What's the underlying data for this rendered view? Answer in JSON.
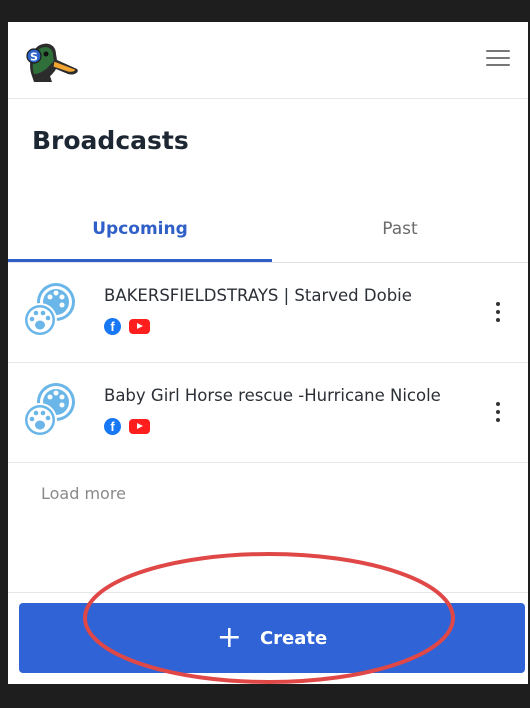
{
  "header": {
    "logo_icon": "duck-mascot-logo-icon",
    "menu_icon": "hamburger-menu-icon"
  },
  "page": {
    "title": "Broadcasts"
  },
  "tabs": [
    {
      "label": "Upcoming",
      "active": true
    },
    {
      "label": "Past",
      "active": false
    }
  ],
  "broadcasts": [
    {
      "title": "BAKERSFIELDSTRAYS | Starved Dobie",
      "platforms": [
        "facebook",
        "youtube"
      ],
      "fb_glyph": "f"
    },
    {
      "title": "Baby Girl Horse rescue -Hurricane Nicole",
      "platforms": [
        "facebook",
        "youtube"
      ],
      "fb_glyph": "f"
    }
  ],
  "load_more": "Load more",
  "create_button": {
    "icon": "+",
    "label": "Create"
  },
  "colors": {
    "accent": "#2f63d6",
    "tab_active": "#2f5fc7",
    "annotation": "#e04848",
    "paw": "#6ab6e8"
  }
}
